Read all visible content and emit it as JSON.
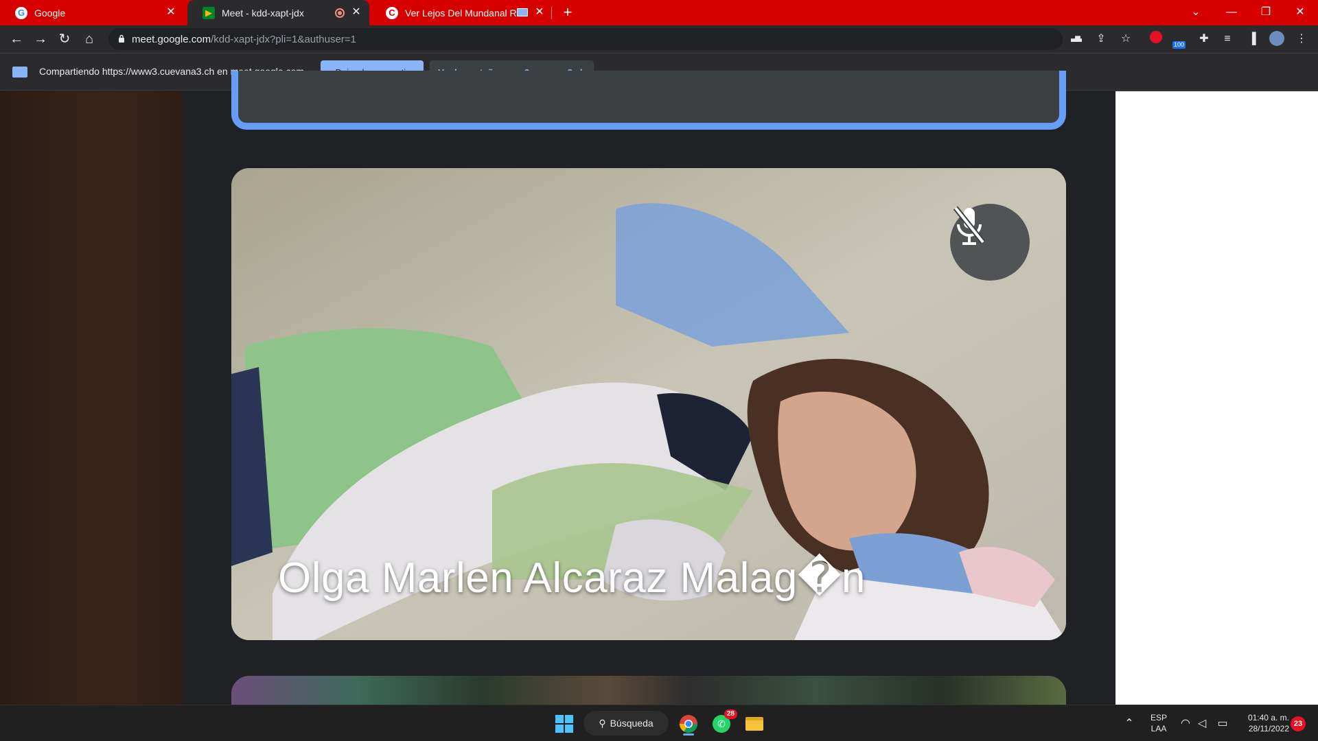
{
  "browser": {
    "tabs": [
      {
        "title": "Google",
        "active": false
      },
      {
        "title": "Meet - kdd-xapt-jdx",
        "active": true
      },
      {
        "title": "Ver Lejos Del Mundanal Ruido",
        "active": false
      }
    ],
    "new_tab": "+",
    "window_controls": {
      "collapse": "⌄",
      "minimize": "—",
      "restore": "❐",
      "close": "✕"
    },
    "url_host": "meet.google.com",
    "url_path": "/kdd-xapt-jdx?pli=1&authuser=1",
    "extension_badge": "100"
  },
  "infobar": {
    "sharing_text": "Compartiendo https://www3.cuevana3.ch en meet.google.com",
    "stop_sharing_label": "Dejar de compartir",
    "view_tab_label": "Ver la pestaña: www3.cuevana3.ch"
  },
  "meet": {
    "participant_name": "Olga Marlen Alcaraz Malag�n",
    "mic_muted": true
  },
  "taskbar": {
    "search_label": "Búsqueda",
    "whatsapp_badge": "28",
    "language_top": "ESP",
    "language_bottom": "LAA",
    "time": "01:40 a. m.",
    "date": "28/11/2022",
    "notification_count": "23"
  },
  "colors": {
    "tabstrip": "#d60000",
    "accent_blue": "#8ab4f8",
    "tile_border": "#669df6",
    "meet_background": "#202124"
  }
}
